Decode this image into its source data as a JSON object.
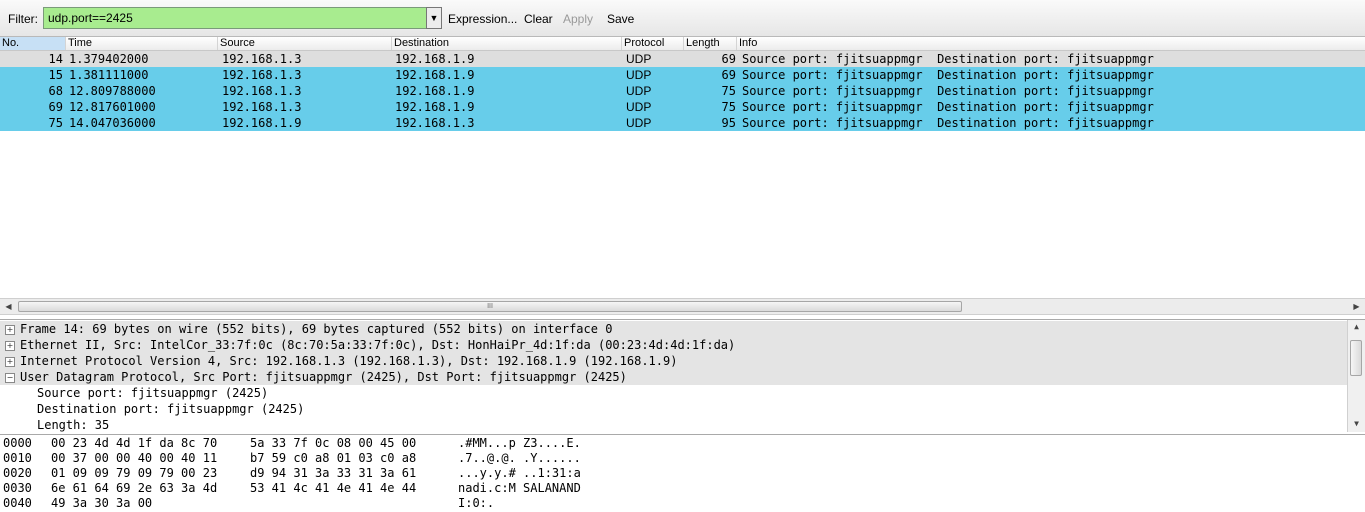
{
  "filter_bar": {
    "label": "Filter:",
    "value": "udp.port==2425",
    "expression_label": "Expression...",
    "clear_label": "Clear",
    "apply_label": "Apply",
    "save_label": "Save",
    "valid_color": "#a8ec8f"
  },
  "packet_list": {
    "columns": [
      "No.",
      "Time",
      "Source",
      "Destination",
      "Protocol",
      "Length",
      "Info"
    ],
    "rows": [
      {
        "no": "14",
        "time": "1.379402000",
        "source": "192.168.1.3",
        "destination": "192.168.1.9",
        "protocol": "UDP",
        "length": "69",
        "info": "Source port: fjitsuappmgr  Destination port: fjitsuappmgr",
        "selected": false
      },
      {
        "no": "15",
        "time": "1.381111000",
        "source": "192.168.1.3",
        "destination": "192.168.1.9",
        "protocol": "UDP",
        "length": "69",
        "info": "Source port: fjitsuappmgr  Destination port: fjitsuappmgr",
        "selected": true
      },
      {
        "no": "68",
        "time": "12.809788000",
        "source": "192.168.1.3",
        "destination": "192.168.1.9",
        "protocol": "UDP",
        "length": "75",
        "info": "Source port: fjitsuappmgr  Destination port: fjitsuappmgr",
        "selected": true
      },
      {
        "no": "69",
        "time": "12.817601000",
        "source": "192.168.1.3",
        "destination": "192.168.1.9",
        "protocol": "UDP",
        "length": "75",
        "info": "Source port: fjitsuappmgr  Destination port: fjitsuappmgr",
        "selected": true
      },
      {
        "no": "75",
        "time": "14.047036000",
        "source": "192.168.1.9",
        "destination": "192.168.1.3",
        "protocol": "UDP",
        "length": "95",
        "info": "Source port: fjitsuappmgr  Destination port: fjitsuappmgr",
        "selected": true
      }
    ],
    "selected_color": "#67cdea",
    "plain_color": "#dedede"
  },
  "hscroll": {
    "grip": "III"
  },
  "details": {
    "tree": [
      {
        "expander": "+",
        "text": "Frame 14: 69 bytes on wire (552 bits), 69 bytes captured (552 bits) on interface 0"
      },
      {
        "expander": "+",
        "text": "Ethernet II, Src: IntelCor_33:7f:0c (8c:70:5a:33:7f:0c), Dst: HonHaiPr_4d:1f:da (00:23:4d:4d:1f:da)"
      },
      {
        "expander": "+",
        "text": "Internet Protocol Version 4, Src: 192.168.1.3 (192.168.1.3), Dst: 192.168.1.9 (192.168.1.9)"
      },
      {
        "expander": "−",
        "text": "User Datagram Protocol, Src Port: fjitsuappmgr (2425), Dst Port: fjitsuappmgr (2425)"
      }
    ],
    "children": [
      "Source port: fjitsuappmgr (2425)",
      "Destination port: fjitsuappmgr (2425)",
      "Length: 35"
    ]
  },
  "hex_dump": [
    {
      "offset": "0000",
      "bytes1": "00 23 4d 4d 1f da 8c 70",
      "bytes2": "5a 33 7f 0c 08 00 45 00",
      "ascii": ".#MM...p Z3....E."
    },
    {
      "offset": "0010",
      "bytes1": "00 37 00 00 40 00 40 11",
      "bytes2": "b7 59 c0 a8 01 03 c0 a8",
      "ascii": ".7..@.@. .Y......"
    },
    {
      "offset": "0020",
      "bytes1": "01 09 09 79 09 79 00 23",
      "bytes2": "d9 94 31 3a 33 31 3a 61",
      "ascii": "...y.y.# ..1:31:a"
    },
    {
      "offset": "0030",
      "bytes1": "6e 61 64 69 2e 63 3a 4d",
      "bytes2": "53 41 4c 41 4e 41 4e 44",
      "ascii": "nadi.c:M SALANAND"
    },
    {
      "offset": "0040",
      "bytes1": "49 3a 30 3a 00",
      "bytes2": "",
      "ascii": "I:0:."
    }
  ]
}
